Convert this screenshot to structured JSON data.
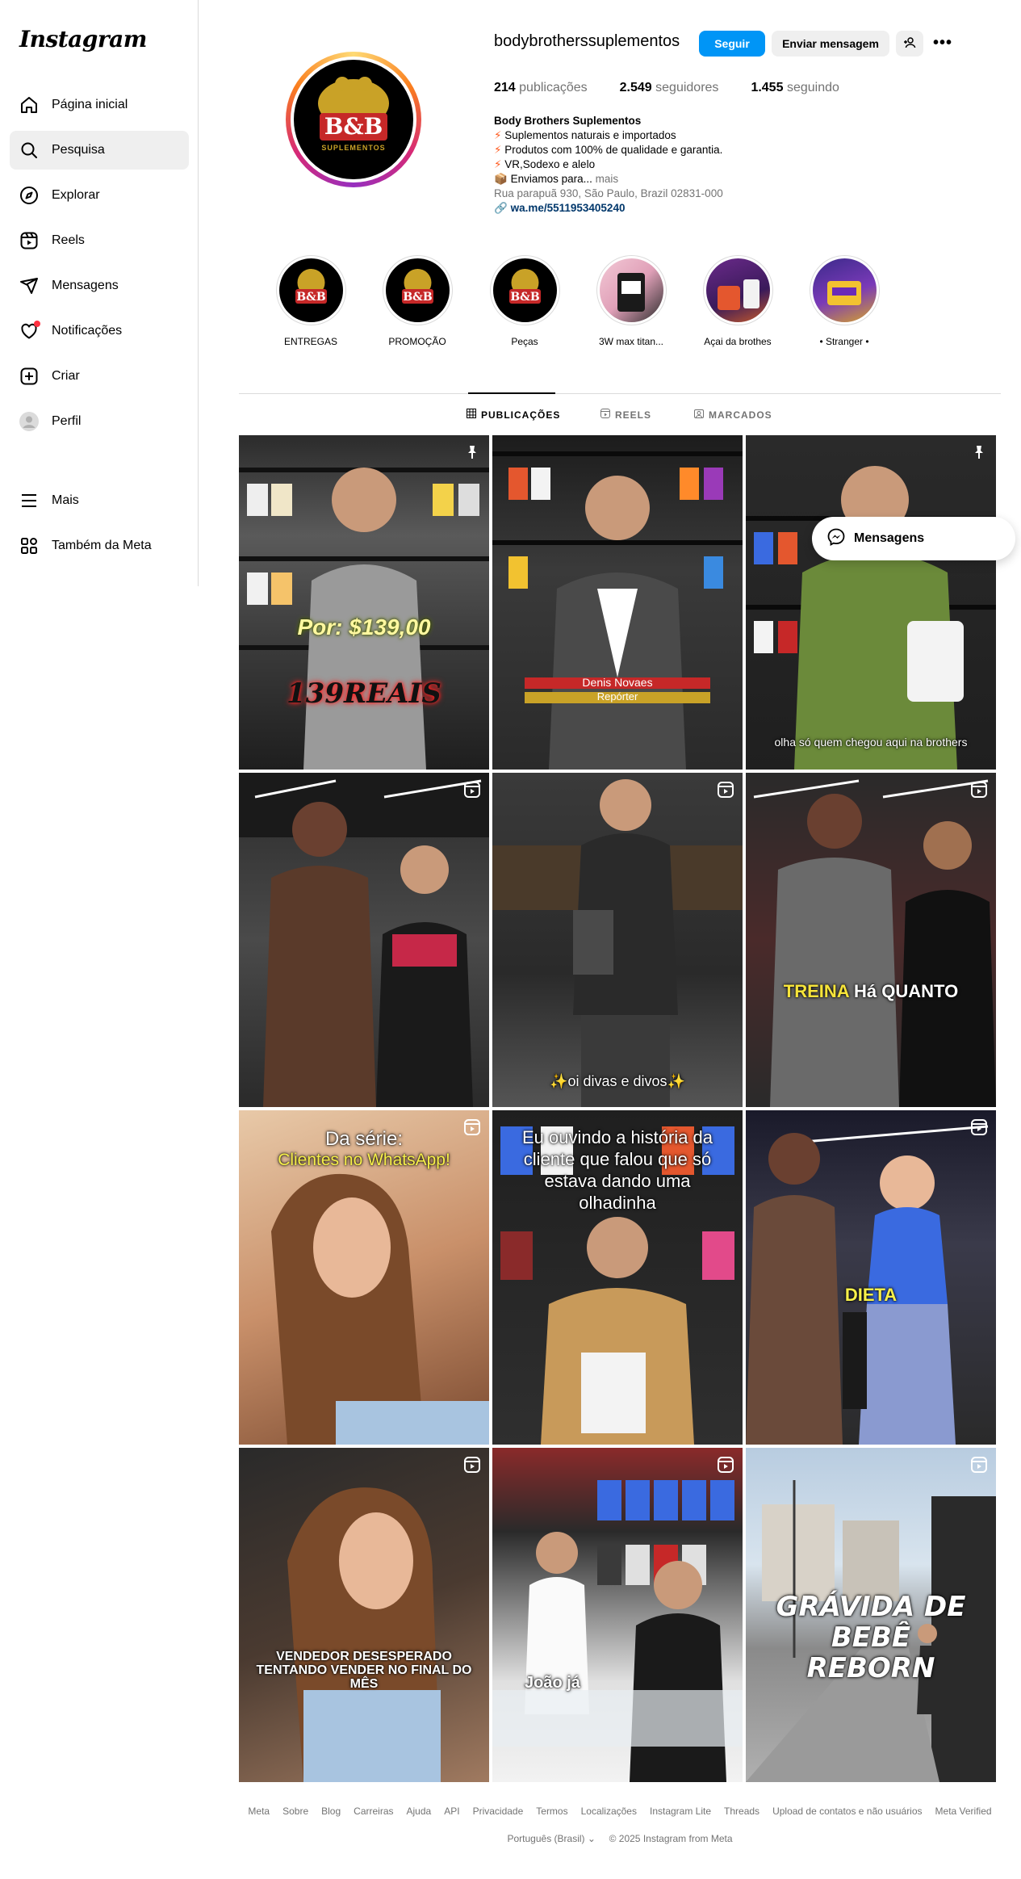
{
  "app": {
    "logo": "Instagram"
  },
  "sidebar": {
    "items": [
      {
        "label": "Página inicial",
        "icon": "home-icon"
      },
      {
        "label": "Pesquisa",
        "icon": "search-icon",
        "active": true
      },
      {
        "label": "Explorar",
        "icon": "compass-icon"
      },
      {
        "label": "Reels",
        "icon": "reels-icon"
      },
      {
        "label": "Mensagens",
        "icon": "send-icon"
      },
      {
        "label": "Notificações",
        "icon": "heart-icon"
      },
      {
        "label": "Criar",
        "icon": "plus-square-icon"
      },
      {
        "label": "Perfil",
        "icon": "profile-avatar"
      },
      {
        "label": "Mais",
        "icon": "menu-icon"
      },
      {
        "label": "Também da Meta",
        "icon": "meta-icon"
      }
    ]
  },
  "profile": {
    "username": "bodybrotherssuplementos",
    "follow_label": "Seguir",
    "message_label": "Enviar mensagem",
    "more_label": "•••",
    "avatar_text": {
      "big": "B&B",
      "small": "SUPLEMENTOS"
    },
    "stats": {
      "posts_n": "214",
      "posts_l": "publicações",
      "followers_n": "2.549",
      "followers_l": "seguidores",
      "following_n": "1.455",
      "following_l": "seguindo"
    },
    "bio": {
      "name": "Body Brothers Suplementos",
      "line1": "Suplementos naturais e importados",
      "line2": "Produtos com 100% de qualidade e garantia.",
      "line3": "VR,Sodexo e alelo",
      "line4": "Enviamos para...",
      "more": "mais",
      "address": "Rua parapuã 930, São Paulo, Brazil 02831-000",
      "link": "wa.me/5511953405240"
    }
  },
  "highlights": [
    {
      "label": "ENTREGAS"
    },
    {
      "label": "PROMOÇÃO"
    },
    {
      "label": "Peças"
    },
    {
      "label": "3W max titan..."
    },
    {
      "label": "Açai da brothes"
    },
    {
      "label": "• Stranger •"
    }
  ],
  "tabs": {
    "posts": "PUBLICAÇÕES",
    "reels": "REELS",
    "tagged": "MARCADOS"
  },
  "posts": [
    {
      "c1": "Por: $139,00",
      "c2": "139REAIS"
    },
    {
      "c1": "Denis Novaes",
      "c2": "Repórter"
    },
    {
      "c1": "olha só quem chegou aqui na brothers"
    },
    {
      "c1": ""
    },
    {
      "c1": "✨oi divas e divos✨"
    },
    {
      "c1": "TREINA",
      "c2": "Há",
      "c3": "QUANTO"
    },
    {
      "c1": "Da série:",
      "c2": "Clientes no WhatsApp!"
    },
    {
      "c1": "Eu ouvindo a história da cliente que falou que só estava dando uma olhadinha"
    },
    {
      "c1": "DIETA"
    },
    {
      "c1": "VENDEDOR DESESPERADO TENTANDO VENDER NO FINAL DO MÊS"
    },
    {
      "c1": "João já"
    },
    {
      "c1": "GRÁVIDA DE BEBÊ REBORN"
    }
  ],
  "floating": {
    "label": "Mensagens"
  },
  "footer": {
    "links": [
      "Meta",
      "Sobre",
      "Blog",
      "Carreiras",
      "Ajuda",
      "API",
      "Privacidade",
      "Termos",
      "Localizações",
      "Instagram Lite",
      "Threads",
      "Upload de contatos e não usuários",
      "Meta Verified"
    ],
    "language": "Português (Brasil)",
    "copyright": "© 2025 Instagram from Meta"
  },
  "colors": {
    "accent": "#0095f6",
    "notification_dot": "#ff3040",
    "link": "#00376b"
  }
}
